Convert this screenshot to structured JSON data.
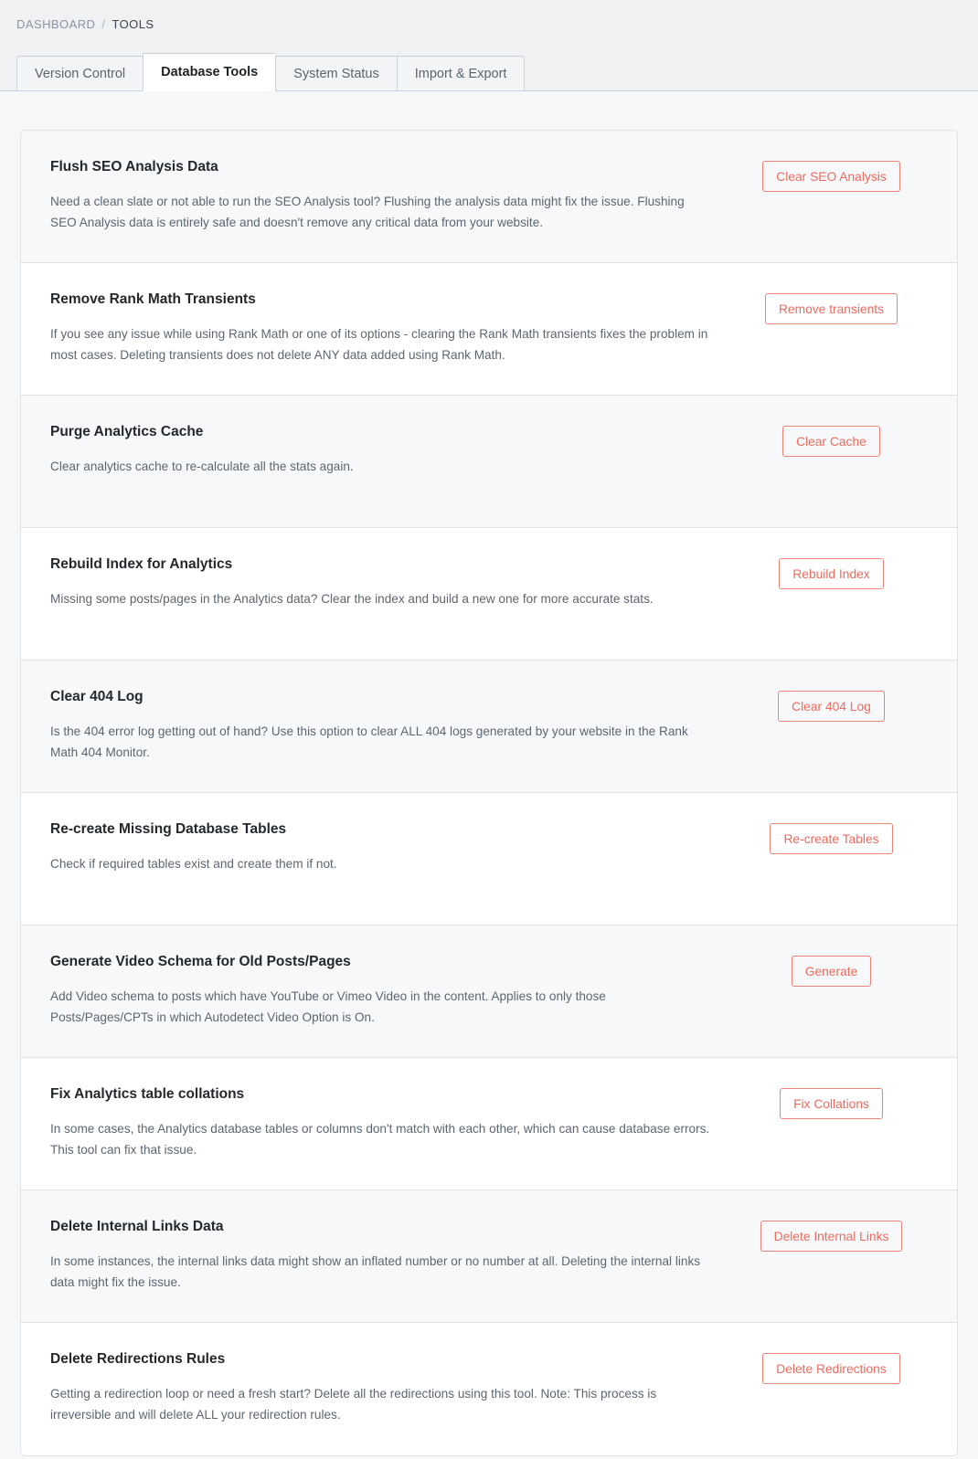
{
  "breadcrumb": {
    "root": "DASHBOARD",
    "separator": "/",
    "current": "TOOLS"
  },
  "tabs": [
    {
      "label": "Version Control",
      "active": false
    },
    {
      "label": "Database Tools",
      "active": true
    },
    {
      "label": "System Status",
      "active": false
    },
    {
      "label": "Import & Export",
      "active": false
    }
  ],
  "colors": {
    "accent": "#ec6b5e",
    "accent_border": "#ec8377",
    "header_bg": "#f0f1f3",
    "page_bg": "#f6f7f9",
    "row_alt_bg": "#f7f8fa",
    "card_border": "#dfe3e8",
    "title_text": "#23282d",
    "body_text": "#5c6670"
  },
  "tools": [
    {
      "title": "Flush SEO Analysis Data",
      "description": "Need a clean slate or not able to run the SEO Analysis tool? Flushing the analysis data might fix the issue. Flushing SEO Analysis data is entirely safe and doesn't remove any critical data from your website.",
      "button": "Clear SEO Analysis"
    },
    {
      "title": "Remove Rank Math Transients",
      "description": "If you see any issue while using Rank Math or one of its options - clearing the Rank Math transients fixes the problem in most cases. Deleting transients does not delete ANY data added using Rank Math.",
      "button": "Remove transients"
    },
    {
      "title": "Purge Analytics Cache",
      "description": "Clear analytics cache to re-calculate all the stats again.",
      "button": "Clear Cache"
    },
    {
      "title": "Rebuild Index for Analytics",
      "description": "Missing some posts/pages in the Analytics data? Clear the index and build a new one for more accurate stats.",
      "button": "Rebuild Index"
    },
    {
      "title": "Clear 404 Log",
      "description": "Is the 404 error log getting out of hand? Use this option to clear ALL 404 logs generated by your website in the Rank Math 404 Monitor.",
      "button": "Clear 404 Log"
    },
    {
      "title": "Re-create Missing Database Tables",
      "description": "Check if required tables exist and create them if not.",
      "button": "Re-create Tables"
    },
    {
      "title": "Generate Video Schema for Old Posts/Pages",
      "description": "Add Video schema to posts which have YouTube or Vimeo Video in the content. Applies to only those Posts/Pages/CPTs in which Autodetect Video Option is On.",
      "button": "Generate"
    },
    {
      "title": "Fix Analytics table collations",
      "description": "In some cases, the Analytics database tables or columns don't match with each other, which can cause database errors. This tool can fix that issue.",
      "button": "Fix Collations"
    },
    {
      "title": "Delete Internal Links Data",
      "description": "In some instances, the internal links data might show an inflated number or no number at all. Deleting the internal links data might fix the issue.",
      "button": "Delete Internal Links"
    },
    {
      "title": "Delete Redirections Rules",
      "description": "Getting a redirection loop or need a fresh start? Delete all the redirections using this tool. Note: This process is irreversible and will delete ALL your redirection rules.",
      "button": "Delete Redirections"
    }
  ]
}
